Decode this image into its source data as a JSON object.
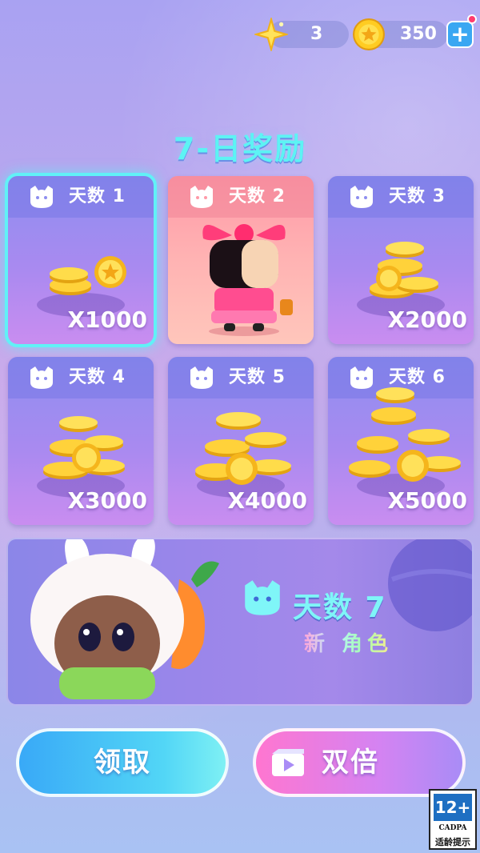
{
  "status": {
    "stars": "3",
    "coins": "350",
    "add_label": "+"
  },
  "title": "7-日奖励",
  "days": [
    {
      "label": "天数 1",
      "amount": "X1000",
      "reward": "coins",
      "selected": true
    },
    {
      "label": "天数 2",
      "amount": "",
      "reward": "character",
      "selected": false
    },
    {
      "label": "天数 3",
      "amount": "X2000",
      "reward": "coins",
      "selected": false
    },
    {
      "label": "天数 4",
      "amount": "X3000",
      "reward": "coins",
      "selected": false
    },
    {
      "label": "天数 5",
      "amount": "X4000",
      "reward": "coins",
      "selected": false
    },
    {
      "label": "天数 6",
      "amount": "X5000",
      "reward": "coins",
      "selected": false
    }
  ],
  "day7": {
    "label": "天数 7",
    "sub": "新 角色"
  },
  "buttons": {
    "claim": "领取",
    "double": "双倍"
  },
  "rating": {
    "age": "12+",
    "org": "CADPA",
    "tip": "适龄提示"
  },
  "colors": {
    "accent": "#5df3f4",
    "selected_outline": "#61f1f7",
    "claim_button": "#39a9f7",
    "double_button": "#ff76d0"
  }
}
